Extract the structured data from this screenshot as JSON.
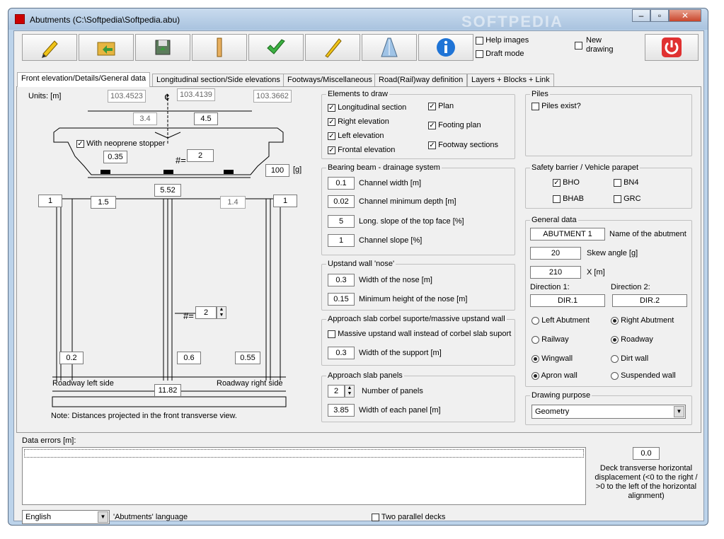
{
  "window": {
    "title": "Abutments (C:\\Softpedia\\Softpedia.abu)",
    "watermark": "SOFTPEDIA"
  },
  "toolbar": {
    "icons": [
      "pencil-icon",
      "open-folder-icon",
      "save-disk-icon",
      "ruler-icon",
      "checkmark-icon",
      "pen-icon",
      "road-icon",
      "info-icon",
      "power-icon"
    ],
    "help_images": "Help images",
    "draft_mode": "Draft mode",
    "new_drawing": "New drawing"
  },
  "tabs": [
    "Front elevation/Details/General data",
    "Longitudinal section/Side elevations",
    "Footways/Miscellaneous",
    "Road(Rail)way definition",
    "Layers + Blocks + Link"
  ],
  "drawing": {
    "units": "Units: [m]",
    "cl": "¢",
    "elev_left": "103.4523",
    "elev_mid": "103.4139",
    "elev_right": "103.3662",
    "w_left": "3.4",
    "w_right": "4.5",
    "neoprene": "With neoprene stopper",
    "gap": "0.35",
    "n_sym": "#=",
    "n_val": "2",
    "angle": "100",
    "angle_unit": "[g]",
    "span": "5.52",
    "col_l": "1",
    "off_l": "1.5",
    "off_r": "1.4",
    "col_r": "1",
    "n2_val": "2",
    "d1": "0.2",
    "d2": "0.6",
    "d3": "0.55",
    "road_left": "Roadway left side",
    "road_right": "Roadway right side",
    "total": "11.82",
    "note": "Note: Distances projected in the front transverse view."
  },
  "elements": {
    "title": "Elements to draw",
    "items": [
      "Longitudinal section",
      "Right elevation",
      "Left elevation",
      "Frontal elevation",
      "Plan",
      "Footing plan",
      "Footway sections"
    ]
  },
  "bearing": {
    "title": "Bearing beam - drainage system",
    "rows": [
      {
        "v": "0.1",
        "l": "Channel width [m]"
      },
      {
        "v": "0.02",
        "l": "Channel minimum depth [m]"
      },
      {
        "v": "5",
        "l": "Long. slope of the top face [%]"
      },
      {
        "v": "1",
        "l": "Channel slope [%]"
      }
    ]
  },
  "upstand": {
    "title": "Upstand wall 'nose'",
    "rows": [
      {
        "v": "0.3",
        "l": "Width of the nose [m]"
      },
      {
        "v": "0.15",
        "l": "Minimum height of the nose [m]"
      }
    ]
  },
  "corbel": {
    "title": "Approach slab corbel suporte/massive upstand wall",
    "massive": "Massive upstand wall instead of corbel slab suport",
    "width_v": "0.3",
    "width_l": "Width of the support [m]"
  },
  "panels": {
    "title": "Approach slab panels",
    "num_v": "2",
    "num_l": "Number of panels",
    "w_v": "3.85",
    "w_l": "Width of each panel [m]"
  },
  "piles": {
    "title": "Piles",
    "exist": "Piles exist?"
  },
  "safety": {
    "title": "Safety barrier / Vehicle parapet",
    "bho": "BHO",
    "bn4": "BN4",
    "bhab": "BHAB",
    "grc": "GRC"
  },
  "general": {
    "title": "General data",
    "name_v": "ABUTMENT 1",
    "name_l": "Name of the abutment",
    "skew_v": "20",
    "skew_l": "Skew angle [g]",
    "x_v": "210",
    "x_l": "X [m]",
    "dir1_l": "Direction 1:",
    "dir2_l": "Direction 2:",
    "dir1_v": "DIR.1",
    "dir2_v": "DIR.2",
    "left_ab": "Left Abutment",
    "right_ab": "Right Abutment",
    "railway": "Railway",
    "roadway": "Roadway",
    "wingwall": "Wingwall",
    "dirtwall": "Dirt wall",
    "apron": "Apron wall",
    "suspended": "Suspended wall"
  },
  "purpose": {
    "title": "Drawing purpose",
    "value": "Geometry"
  },
  "errors": {
    "label": "Data errors [m]:"
  },
  "deck": {
    "value": "0.0",
    "label": "Deck transverse horizontal displacement (<0 to the right / >0 to the left of the horizontal alignment)"
  },
  "footer": {
    "language": "English",
    "lang_label": "'Abutments' language",
    "parallel": "Two parallel decks"
  }
}
